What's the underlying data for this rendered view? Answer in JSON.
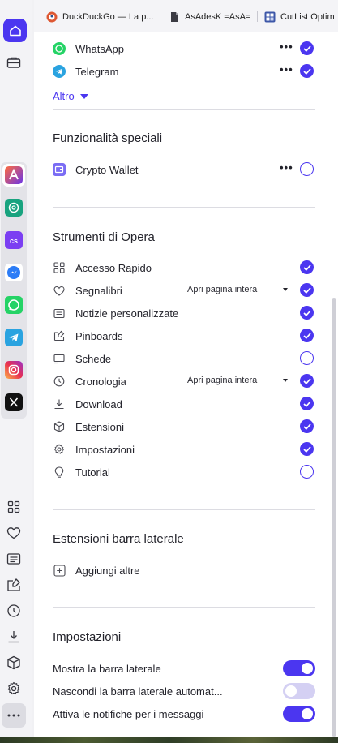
{
  "bookmarks": [
    {
      "label": "DuckDuckGo — La p...",
      "icon": "duckduckgo-icon"
    },
    {
      "label": "AsAdesK =AsA=",
      "icon": "document-icon"
    },
    {
      "label": "CutList Optim",
      "icon": "cutlist-icon"
    }
  ],
  "rail": {
    "top": [
      "opera-logo-icon",
      "workspaces-briefcase-icon"
    ],
    "apps": [
      "aria-icon",
      "chatgpt-icon",
      "chatsonic-icon",
      "messenger-icon",
      "whatsapp-icon",
      "telegram-icon",
      "instagram-icon",
      "x-icon"
    ],
    "bottom": [
      "speed-dial-icon",
      "bookmarks-heart-icon",
      "news-icon",
      "pinboards-icon",
      "history-clock-icon",
      "download-icon",
      "extensions-cube-icon",
      "settings-gear-icon",
      "more-dots-icon"
    ]
  },
  "messengers": [
    {
      "label": "WhatsApp",
      "dots": "•••",
      "enabled": true
    },
    {
      "label": "Telegram",
      "dots": "•••",
      "enabled": true
    }
  ],
  "altro_label": "Altro",
  "special": {
    "title": "Funzionalità speciali",
    "items": [
      {
        "label": "Crypto Wallet",
        "dots": "•••",
        "enabled": false
      }
    ]
  },
  "tools": {
    "title": "Strumenti di Opera",
    "items": [
      {
        "label": "Accesso Rapido",
        "enabled": true
      },
      {
        "label": "Segnalibri",
        "select": "Apri pagina intera",
        "enabled": true
      },
      {
        "label": "Notizie personalizzate",
        "enabled": true
      },
      {
        "label": "Pinboards",
        "enabled": true
      },
      {
        "label": "Schede",
        "enabled": false
      },
      {
        "label": "Cronologia",
        "select": "Apri pagina intera",
        "enabled": true
      },
      {
        "label": "Download",
        "enabled": true
      },
      {
        "label": "Estensioni",
        "enabled": true
      },
      {
        "label": "Impostazioni",
        "enabled": true
      },
      {
        "label": "Tutorial",
        "enabled": false
      }
    ]
  },
  "extensions": {
    "title": "Estensioni barra laterale",
    "add_label": "Aggiungi altre"
  },
  "settings": {
    "title": "Impostazioni",
    "toggles": [
      {
        "label": "Mostra la barra laterale",
        "on": true
      },
      {
        "label": "Nascondi la barra laterale automat...",
        "on": false
      },
      {
        "label": "Attiva le notifiche per i messaggi",
        "on": true
      }
    ]
  },
  "colors": {
    "accent": "#4b36f0",
    "accent_light": "#d4d0f3"
  }
}
